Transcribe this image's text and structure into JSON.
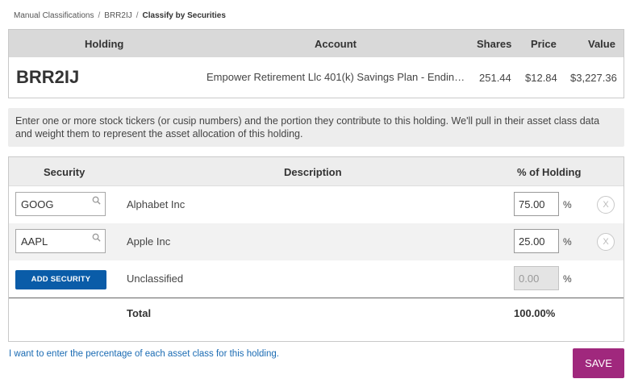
{
  "breadcrumb": {
    "items": [
      "Manual Classifications",
      "BRR2IJ"
    ],
    "current": "Classify by Securities"
  },
  "holding_table": {
    "headers": {
      "holding": "Holding",
      "account": "Account",
      "shares": "Shares",
      "price": "Price",
      "value": "Value"
    },
    "row": {
      "holding": "BRR2IJ",
      "account": "Empower Retirement Llc 401(k) Savings Plan - Endin…",
      "shares": "251.44",
      "price": "$12.84",
      "value": "$3,227.36"
    }
  },
  "info_text": "Enter one or more stock tickers (or cusip numbers) and the portion they contribute to this holding. We'll pull in their asset class data and weight them to represent the asset allocation of this holding.",
  "securities_table": {
    "headers": {
      "security": "Security",
      "description": "Description",
      "percent": "% of Holding"
    },
    "rows": [
      {
        "ticker": "GOOG",
        "description": "Alphabet Inc",
        "percent": "75.00",
        "percent_sign": "%",
        "remove": "X"
      },
      {
        "ticker": "AAPL",
        "description": "Apple Inc",
        "percent": "25.00",
        "percent_sign": "%",
        "remove": "X"
      }
    ],
    "unclassified": {
      "add_button": "ADD SECURITY",
      "description": "Unclassified",
      "percent": "0.00",
      "percent_sign": "%"
    },
    "total": {
      "label": "Total",
      "value": "100.00%"
    }
  },
  "footer": {
    "link": "I want to enter the percentage of each asset class for this holding.",
    "save": "SAVE"
  },
  "colors": {
    "header_gray": "#d9d9d9",
    "add_button_blue": "#0a5ca8",
    "save_button_magenta": "#a0287d",
    "link_blue": "#1a6bb3"
  }
}
